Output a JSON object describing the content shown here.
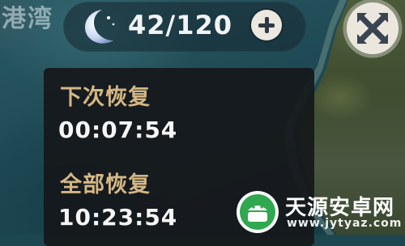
{
  "map": {
    "title_fragment": "港湾"
  },
  "resin": {
    "icon": "crescent-moon-icon",
    "count": "42/120",
    "add_icon": "plus-icon"
  },
  "close": {
    "icon": "close-x-icon"
  },
  "recovery": {
    "next_label": "下次恢复",
    "next_time": "00:07:54",
    "full_label": "全部恢复",
    "full_time": "10:23:54"
  },
  "watermark": {
    "name": "天源安卓网",
    "url": "www.jytyaz.com",
    "logo_color": "#2fa84f"
  },
  "colors": {
    "label_gold": "#d5b784",
    "time_white": "#f5f5f5",
    "panel_bg": "#16181b"
  }
}
